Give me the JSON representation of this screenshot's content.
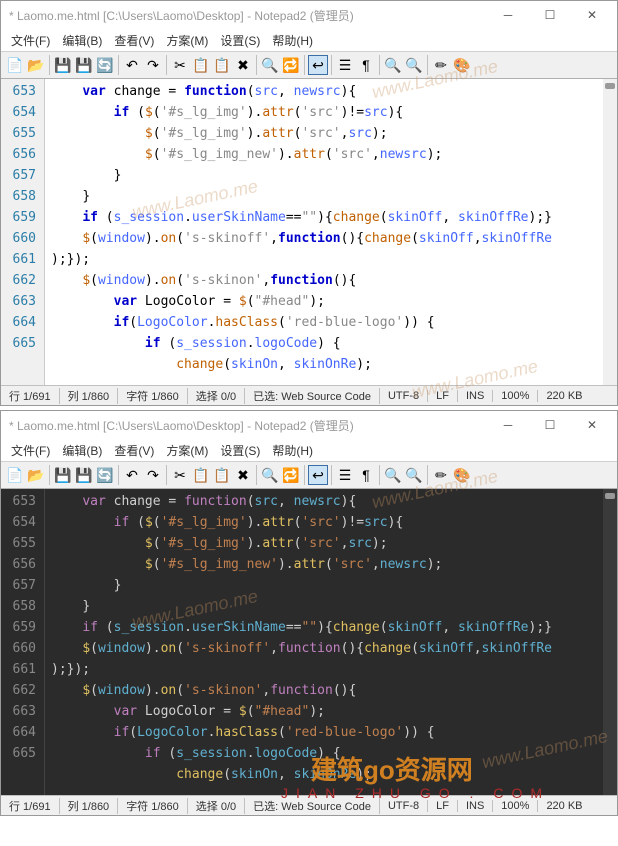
{
  "title": "* Laomo.me.html [C:\\Users\\Laomo\\Desktop] - Notepad2 (管理员)",
  "menus": [
    "文件(F)",
    "编辑(B)",
    "查看(V)",
    "方案(M)",
    "设置(S)",
    "帮助(H)"
  ],
  "linenos": [
    "653",
    "654",
    "655",
    "656",
    "657",
    "658",
    "659",
    "660",
    "",
    "661",
    "662",
    "663",
    "664",
    "665",
    ""
  ],
  "code_lines": [
    {
      "i": "    ",
      "t": [
        [
          "kw",
          "var"
        ],
        [
          "op",
          " change "
        ],
        [
          "op",
          "= "
        ],
        [
          "kw",
          "function"
        ],
        [
          "punc",
          "("
        ],
        [
          "name",
          "src"
        ],
        [
          "punc",
          ", "
        ],
        [
          "name",
          "newsrc"
        ],
        [
          "punc",
          "){"
        ]
      ]
    },
    {
      "i": "        ",
      "t": [
        [
          "kw",
          "if"
        ],
        [
          "op",
          " ("
        ],
        [
          "fn",
          "$"
        ],
        [
          "punc",
          "("
        ],
        [
          "str",
          "'#s_lg_img'"
        ],
        [
          "punc",
          ")."
        ],
        [
          "fn",
          "attr"
        ],
        [
          "punc",
          "("
        ],
        [
          "str",
          "'src'"
        ],
        [
          "punc",
          ")"
        ],
        [
          "op",
          "!="
        ],
        [
          "name",
          "src"
        ],
        [
          "punc",
          ")"
        ],
        [
          "punc",
          "{"
        ]
      ]
    },
    {
      "i": "            ",
      "t": [
        [
          "fn",
          "$"
        ],
        [
          "punc",
          "("
        ],
        [
          "str",
          "'#s_lg_img'"
        ],
        [
          "punc",
          ")."
        ],
        [
          "fn",
          "attr"
        ],
        [
          "punc",
          "("
        ],
        [
          "str",
          "'src'"
        ],
        [
          "punc",
          ","
        ],
        [
          "name",
          "src"
        ],
        [
          "punc",
          ");"
        ]
      ]
    },
    {
      "i": "            ",
      "t": [
        [
          "fn",
          "$"
        ],
        [
          "punc",
          "("
        ],
        [
          "str",
          "'#s_lg_img_new'"
        ],
        [
          "punc",
          ")."
        ],
        [
          "fn",
          "attr"
        ],
        [
          "punc",
          "("
        ],
        [
          "str",
          "'src'"
        ],
        [
          "punc",
          ","
        ],
        [
          "name",
          "newsrc"
        ],
        [
          "punc",
          ");"
        ]
      ]
    },
    {
      "i": "        ",
      "t": [
        [
          "punc",
          "}"
        ]
      ]
    },
    {
      "i": "    ",
      "t": [
        [
          "punc",
          "}"
        ]
      ]
    },
    {
      "i": "    ",
      "t": [
        [
          "kw",
          "if"
        ],
        [
          "op",
          " ("
        ],
        [
          "name",
          "s_session"
        ],
        [
          "punc",
          "."
        ],
        [
          "name",
          "userSkinName"
        ],
        [
          "op",
          "=="
        ],
        [
          "str",
          "\"\""
        ],
        [
          "punc",
          ")"
        ],
        [
          "punc",
          "{"
        ],
        [
          "fn",
          "change"
        ],
        [
          "punc",
          "("
        ],
        [
          "name",
          "skinOff"
        ],
        [
          "punc",
          ", "
        ],
        [
          "name",
          "skinOffRe"
        ],
        [
          "punc",
          ");"
        ],
        [
          "punc",
          "}"
        ]
      ]
    },
    {
      "i": "    ",
      "t": [
        [
          "fn",
          "$"
        ],
        [
          "punc",
          "("
        ],
        [
          "name",
          "window"
        ],
        [
          "punc",
          ")."
        ],
        [
          "fn",
          "on"
        ],
        [
          "punc",
          "("
        ],
        [
          "str",
          "'s-skinoff'"
        ],
        [
          "punc",
          ","
        ],
        [
          "kw",
          "function"
        ],
        [
          "punc",
          "()"
        ],
        [
          "punc",
          "{"
        ],
        [
          "fn",
          "change"
        ],
        [
          "punc",
          "("
        ],
        [
          "name",
          "skinOff"
        ],
        [
          "punc",
          ","
        ],
        [
          "name",
          "skinOffRe"
        ]
      ]
    },
    {
      "i": "",
      "t": [
        [
          "punc",
          ");});"
        ]
      ]
    },
    {
      "i": "",
      "t": []
    },
    {
      "i": "    ",
      "t": [
        [
          "fn",
          "$"
        ],
        [
          "punc",
          "("
        ],
        [
          "name",
          "window"
        ],
        [
          "punc",
          ")."
        ],
        [
          "fn",
          "on"
        ],
        [
          "punc",
          "("
        ],
        [
          "str",
          "'s-skinon'"
        ],
        [
          "punc",
          ","
        ],
        [
          "kw",
          "function"
        ],
        [
          "punc",
          "()"
        ],
        [
          "punc",
          "{"
        ]
      ]
    },
    {
      "i": "        ",
      "t": [
        [
          "kw",
          "var"
        ],
        [
          "op",
          " LogoColor "
        ],
        [
          "op",
          "= "
        ],
        [
          "fn",
          "$"
        ],
        [
          "punc",
          "("
        ],
        [
          "str",
          "\"#head\""
        ],
        [
          "punc",
          ");"
        ]
      ]
    },
    {
      "i": "        ",
      "t": [
        [
          "kw",
          "if"
        ],
        [
          "punc",
          "("
        ],
        [
          "name",
          "LogoColor"
        ],
        [
          "punc",
          "."
        ],
        [
          "fn",
          "hasClass"
        ],
        [
          "punc",
          "("
        ],
        [
          "str",
          "'red-blue-logo'"
        ],
        [
          "punc",
          "))"
        ],
        [
          "op",
          " "
        ],
        [
          "punc",
          "{"
        ]
      ]
    },
    {
      "i": "            ",
      "t": [
        [
          "kw",
          "if"
        ],
        [
          "op",
          " ("
        ],
        [
          "name",
          "s_session"
        ],
        [
          "punc",
          "."
        ],
        [
          "name",
          "logoCode"
        ],
        [
          "punc",
          ")"
        ],
        [
          "op",
          " "
        ],
        [
          "punc",
          "{"
        ]
      ]
    },
    {
      "i": "                ",
      "t": [
        [
          "fn",
          "change"
        ],
        [
          "punc",
          "("
        ],
        [
          "name",
          "skinOn"
        ],
        [
          "punc",
          ", "
        ],
        [
          "name",
          "skinOnRe"
        ],
        [
          "punc",
          ");"
        ]
      ]
    }
  ],
  "status": {
    "pos": "行 1/691",
    "col": "列 1/860",
    "chars": "字符 1/860",
    "sel": "选择 0/0",
    "enc": "已选: Web Source Code",
    "utf": "UTF-8",
    "lf": "LF",
    "ins": "INS",
    "zoom": "100%",
    "size": "220 KB"
  },
  "watermark": "www.Laomo.me",
  "footer1": "建筑go资源网",
  "footer2": "JIAN ZHU GO . COM"
}
